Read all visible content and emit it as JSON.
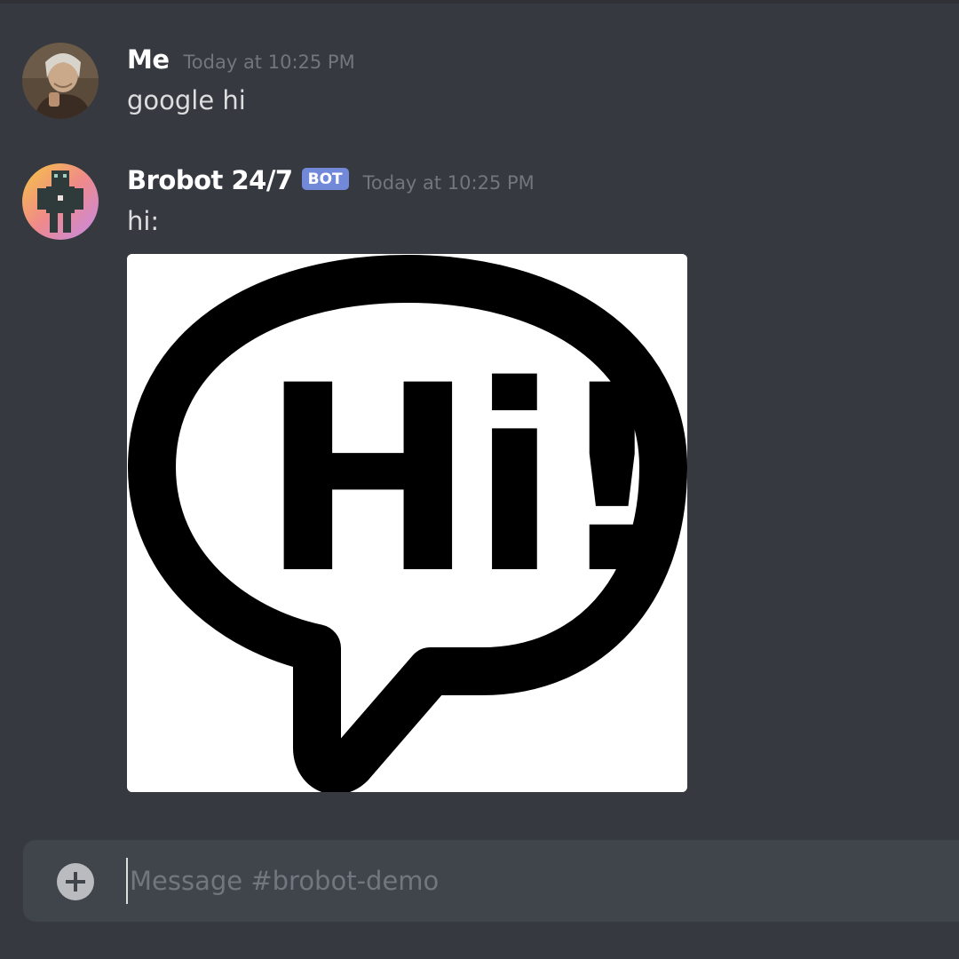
{
  "channel": {
    "name": "brobot-demo"
  },
  "messages": [
    {
      "author": "Me",
      "timestamp": "Today at 10:25 PM",
      "content": "google hi",
      "is_bot": false
    },
    {
      "author": "Brobot 24/7",
      "bot_tag": "BOT",
      "timestamp": "Today at 10:25 PM",
      "content": "hi:",
      "is_bot": true,
      "attachment": {
        "kind": "image",
        "text": "Hi!",
        "icon": "speech-bubble-icon"
      }
    }
  ],
  "composer": {
    "placeholder": "Message #brobot-demo",
    "value": "",
    "attach_icon": "plus-circle-icon"
  },
  "colors": {
    "background": "#36393f",
    "composer": "#40444b",
    "bot_tag": "#7289da",
    "username": "#ffffff",
    "timestamp": "#72767d",
    "text": "#dcddde"
  }
}
